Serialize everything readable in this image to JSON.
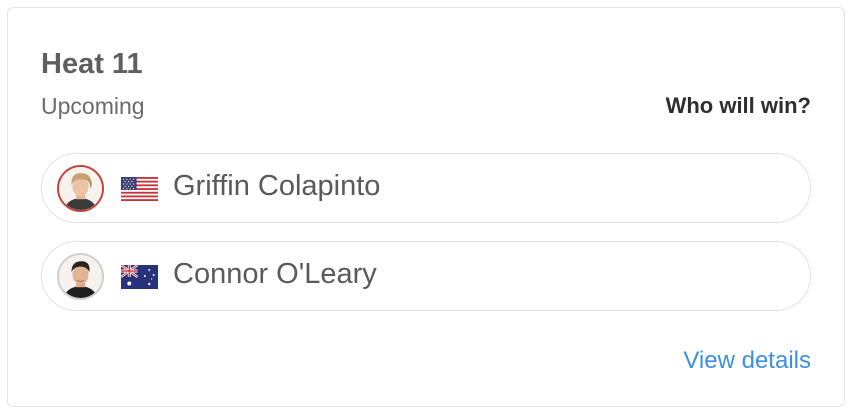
{
  "heat": {
    "title": "Heat 11",
    "status": "Upcoming",
    "prompt": "Who will win?"
  },
  "competitors": [
    {
      "name": "Griffin Colapinto",
      "flag": "us-flag-icon",
      "ring_color": "#c9413b"
    },
    {
      "name": "Connor O'Leary",
      "flag": "au-flag-icon",
      "ring_color": "#cfcfcf"
    }
  ],
  "footer": {
    "details_label": "View details",
    "link_color": "#3d8fe0"
  }
}
